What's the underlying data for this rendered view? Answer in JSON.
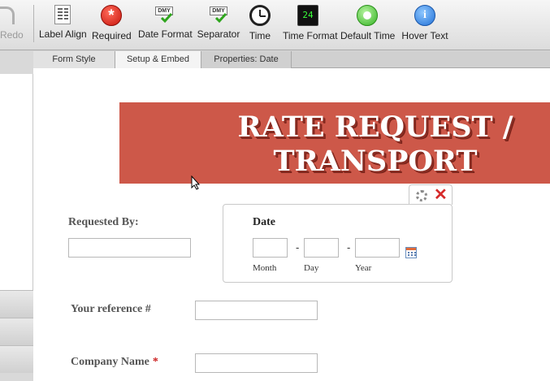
{
  "toolbar": {
    "redo_label": "Redo",
    "buttons": [
      {
        "label": "Label Align",
        "icon": "label-align-icon"
      },
      {
        "label": "Required",
        "icon": "required-icon",
        "glyph": "*"
      },
      {
        "label": "Date Format",
        "icon": "date-format-icon",
        "glyph": "DMY"
      },
      {
        "label": "Separator",
        "icon": "separator-icon",
        "glyph": "DMY"
      },
      {
        "label": "Time",
        "icon": "clock-icon"
      },
      {
        "label": "Time Format",
        "icon": "time-format-icon",
        "glyph": "24"
      },
      {
        "label": "Default Time",
        "icon": "default-time-icon"
      },
      {
        "label": "Hover Text",
        "icon": "info-icon",
        "glyph": "i"
      }
    ]
  },
  "tabs": [
    {
      "label": "Form Style"
    },
    {
      "label": "Setup & Embed"
    },
    {
      "label": "Properties: Date"
    }
  ],
  "form": {
    "banner_title": "RATE REQUEST / TRANSPORT",
    "requested_by_label": "Requested By:",
    "requested_by_value": "",
    "date": {
      "title": "Date",
      "separator": "-",
      "month_label": "Month",
      "day_label": "Day",
      "year_label": "Year"
    },
    "reference_label": "Your reference #",
    "company_label": "Company Name",
    "required_mark": "*"
  },
  "colors": {
    "banner": "#cd5849",
    "required": "#cc2020",
    "close": "#d62a2a"
  }
}
